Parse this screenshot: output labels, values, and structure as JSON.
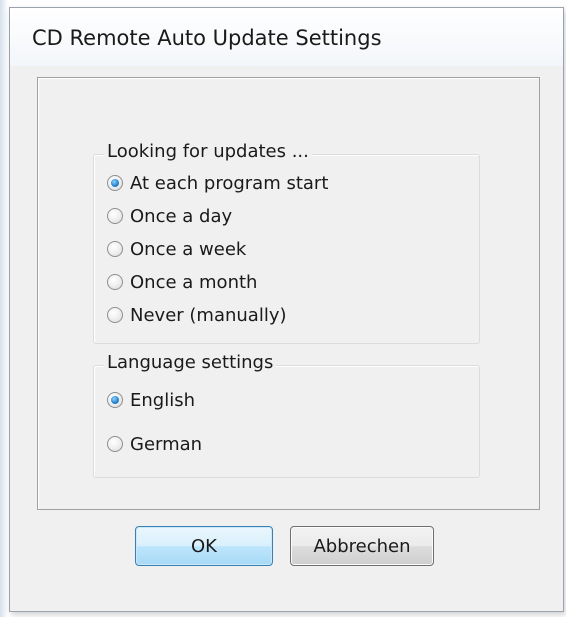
{
  "window": {
    "title": "CD Remote Auto Update Settings"
  },
  "updates_group": {
    "legend": "Looking for updates ...",
    "options": [
      {
        "label": "At each program start",
        "checked": true
      },
      {
        "label": "Once a day",
        "checked": false
      },
      {
        "label": "Once a week",
        "checked": false
      },
      {
        "label": "Once a month",
        "checked": false
      },
      {
        "label": "Never (manually)",
        "checked": false
      }
    ]
  },
  "language_group": {
    "legend": "Language settings",
    "options": [
      {
        "label": "English",
        "checked": true
      },
      {
        "label": "German",
        "checked": false
      }
    ]
  },
  "buttons": {
    "ok_label": "OK",
    "cancel_label": "Abbrechen"
  },
  "colors": {
    "accent": "#2a86cf",
    "dialog_background": "#f0f0f0",
    "ok_button_border": "#3c7fb1"
  }
}
